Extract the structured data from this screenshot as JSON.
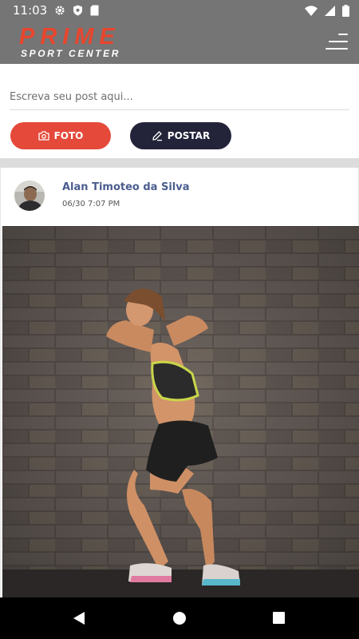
{
  "status_bar": {
    "time": "11:03",
    "icons": [
      "gear-icon",
      "shield-icon",
      "sd-card-icon",
      "wifi-icon",
      "signal-icon",
      "battery-icon"
    ]
  },
  "app_bar": {
    "logo_main": "PRIME",
    "logo_sub": "SPORT CENTER",
    "menu_icon": "hamburger-menu-icon"
  },
  "compose": {
    "placeholder": "Escreva seu post aqui...",
    "value": "",
    "photo_button_label": "FOTO",
    "post_button_label": "POSTAR"
  },
  "post": {
    "author": "Alan Timoteo da Silva",
    "timestamp": "06/30 7:07 PM"
  },
  "nav_bar": {
    "buttons": [
      "back-icon",
      "home-icon",
      "recents-icon"
    ]
  },
  "colors": {
    "brand_red": "#e4493a",
    "dark_button": "#23243a",
    "app_bar": "#757575",
    "author_link": "#4a5d8e"
  }
}
